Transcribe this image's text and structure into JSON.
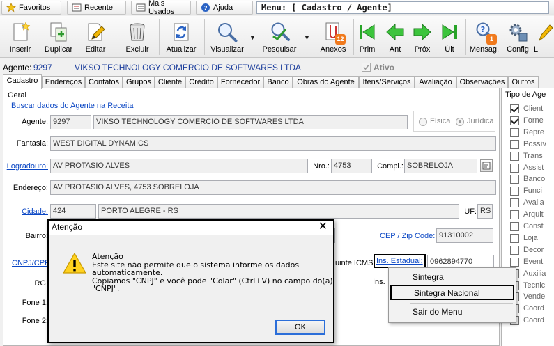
{
  "topbar": {
    "favoritos": "Favoritos",
    "recente": "Recente",
    "mais_usados": "Mais Usados",
    "ajuda": "Ajuda",
    "menu_title": "Menu: [ Cadastro / Agente]"
  },
  "toolbar": {
    "inserir": "Inserir",
    "duplicar": "Duplicar",
    "editar": "Editar",
    "excluir": "Excluir",
    "atualizar": "Atualizar",
    "visualizar": "Visualizar",
    "pesquisar": "Pesquisar",
    "anexos": "Anexos",
    "anexos_badge": "12",
    "prim": "Prim",
    "ant": "Ant",
    "prox": "Próx",
    "ult": "Últ",
    "mensag": "Mensag.",
    "mensag_badge": "1",
    "config": "Config",
    "cut": "L"
  },
  "agent": {
    "label": "Agente:",
    "code": "9297",
    "name": "VIKSO TECHNOLOGY COMERCIO DE SOFTWARES LTDA",
    "ativo": "Ativo"
  },
  "tabs": [
    "Cadastro",
    "Endereços",
    "Contatos",
    "Grupos",
    "Cliente",
    "Crédito",
    "Fornecedor",
    "Banco",
    "Obras do Agente",
    "Itens/Serviços",
    "Avaliação",
    "Observações",
    "Outros"
  ],
  "form": {
    "geral": "Geral",
    "buscar": "Buscar dados do Agente na Receita",
    "agente_label": "Agente:",
    "agente_code": "9297",
    "agente_name": "VIKSO TECHNOLOGY COMERCIO DE SOFTWARES LTDA",
    "fisica": "Física",
    "juridica": "Jurídica",
    "fantasia_label": "Fantasia:",
    "fantasia": "WEST DIGITAL DYNAMICS",
    "logradouro_label": "Logradouro:",
    "logradouro": "AV PROTASIO ALVES",
    "nro_label": "Nro.:",
    "nro": "4753",
    "compl_label": "Compl.:",
    "compl": "SOBRELOJA",
    "endereco_label": "Endereço:",
    "endereco": "AV PROTASIO ALVES, 4753 SOBRELOJA",
    "cidade_label": "Cidade:",
    "cidade_code": "424",
    "cidade": "PORTO ALEGRE - RS",
    "uf_label": "UF:",
    "uf": "RS",
    "bairro_label": "Bairro:",
    "cep_label": "CEP / Zip Code:",
    "cep": "91310002",
    "cnpj_label": "CNPJ/CPF:",
    "contrib_label": "uinte ICMS",
    "ins_estadual_label": "Ins. Estadual:",
    "ins_estadual": "0962894770",
    "rg_label": "RG:",
    "ins_label2": "Ins.",
    "fone1_label": "Fone 1:",
    "fone2_label": "Fone 2:"
  },
  "tipo_agente": {
    "title": "Tipo de Age",
    "items": [
      {
        "label": "Client",
        "checked": true
      },
      {
        "label": "Forne",
        "checked": true
      },
      {
        "label": "Repre",
        "checked": false
      },
      {
        "label": "Possív",
        "checked": false
      },
      {
        "label": "Trans",
        "checked": false
      },
      {
        "label": "Assist",
        "checked": false
      },
      {
        "label": "Banco",
        "checked": false
      },
      {
        "label": "Funci",
        "checked": false
      },
      {
        "label": "Avalia",
        "checked": false
      },
      {
        "label": "Arquit",
        "checked": false
      },
      {
        "label": "Const",
        "checked": false
      },
      {
        "label": "Loja",
        "checked": false
      },
      {
        "label": "Decor",
        "checked": false
      },
      {
        "label": "Event",
        "checked": false
      },
      {
        "label": "Auxilia",
        "checked": false
      },
      {
        "label": "Tecnic",
        "checked": false
      },
      {
        "label": "Vende",
        "checked": false
      },
      {
        "label": "Coord",
        "checked": false
      },
      {
        "label": "Coord",
        "checked": false
      }
    ]
  },
  "dialog": {
    "title": "Atenção",
    "message": "Atenção\nEste site não permite que o sistema informe os dados\nautomaticamente.\nCopiamos \"CNPJ\" e você pode \"Colar\" (Ctrl+V) no campo do(a)\n\"CNPJ\".",
    "ok": "OK"
  },
  "context_menu": {
    "items": [
      "Sintegra",
      "Sintegra Nacional",
      "Sair do Menu"
    ]
  }
}
